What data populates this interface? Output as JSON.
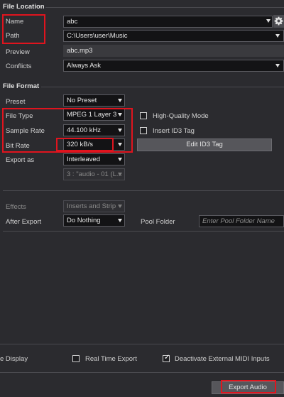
{
  "file_location": {
    "title": "File Location",
    "name_label": "Name",
    "name_value": "abc",
    "path_label": "Path",
    "path_value": "C:\\Users\\user\\Music",
    "preview_label": "Preview",
    "preview_value": "abc.mp3",
    "conflicts_label": "Conflicts",
    "conflicts_value": "Always Ask"
  },
  "file_format": {
    "title": "File Format",
    "preset_label": "Preset",
    "preset_value": "No Preset",
    "file_type_label": "File Type",
    "file_type_value": "MPEG 1 Layer 3",
    "sample_rate_label": "Sample Rate",
    "sample_rate_value": "44.100 kHz",
    "bit_rate_label": "Bit Rate",
    "bit_rate_value": "320 kB/s",
    "export_as_label": "Export as",
    "export_as_value": "Interleaved",
    "channels_value": "3 : \"audio - 01 (L...",
    "hq_mode_label": "High-Quality Mode",
    "insert_id3_label": "Insert ID3 Tag",
    "edit_id3_label": "Edit ID3 Tag"
  },
  "post": {
    "effects_label": "Effects",
    "effects_value": "Inserts and Strip",
    "after_export_label": "After Export",
    "after_export_value": "Do Nothing",
    "pool_folder_label": "Pool Folder",
    "pool_folder_placeholder": "Enter Pool Folder Name"
  },
  "footer": {
    "display_label": "e Display",
    "realtime_label": "Real Time Export",
    "realtime_checked": false,
    "deactivate_midi_label": "Deactivate External MIDI Inputs",
    "deactivate_midi_checked": true,
    "export_button": "Export Audio"
  },
  "icons": [
    "gear-icon",
    "chevron-down-icon",
    "check-icon"
  ],
  "colors": {
    "background": "#2b2b2f",
    "highlight": "#e0141e"
  }
}
